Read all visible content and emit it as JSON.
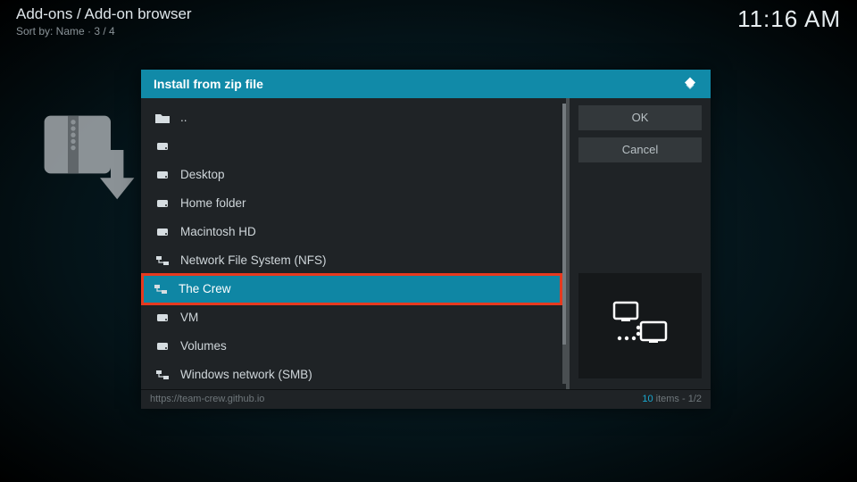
{
  "header": {
    "breadcrumb": "Add-ons / Add-on browser",
    "sort_line": "Sort by: Name  ·  3 / 4",
    "clock": "11:16 AM"
  },
  "dialog": {
    "title": "Install from zip file",
    "buttons": {
      "ok": "OK",
      "cancel": "Cancel"
    },
    "items": [
      {
        "label": "..",
        "icon": "folder-up",
        "selected": false
      },
      {
        "label": "",
        "icon": "drive",
        "selected": false
      },
      {
        "label": "Desktop",
        "icon": "drive",
        "selected": false
      },
      {
        "label": "Home folder",
        "icon": "drive",
        "selected": false
      },
      {
        "label": "Macintosh HD",
        "icon": "drive",
        "selected": false
      },
      {
        "label": "Network File System (NFS)",
        "icon": "network",
        "selected": false
      },
      {
        "label": "The Crew",
        "icon": "network",
        "selected": true
      },
      {
        "label": "VM",
        "icon": "drive",
        "selected": false
      },
      {
        "label": "Volumes",
        "icon": "drive",
        "selected": false
      },
      {
        "label": "Windows network (SMB)",
        "icon": "network",
        "selected": false
      }
    ],
    "footer_url": "https://team-crew.github.io",
    "footer_count_hl": "10",
    "footer_count_tail": " items - 1/2"
  },
  "colors": {
    "accent": "#118aa8",
    "highlight_border": "#e63a1f"
  }
}
